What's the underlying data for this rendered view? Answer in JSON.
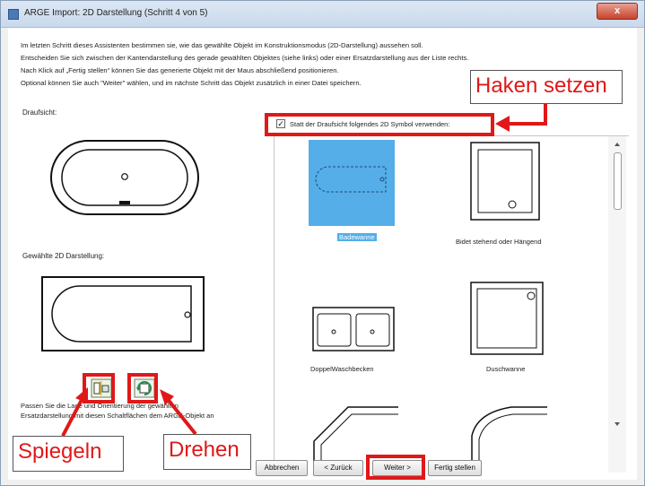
{
  "window": {
    "title": "ARGE Import: 2D Darstellung (Schritt 4 von 5)",
    "close_glyph": "x"
  },
  "intro": {
    "lines": [
      "Im letzten Schritt dieses Assistenten bestimmen sie, wie das gewählte Objekt im Konstruktionsmodus (2D-Darstellung) aussehen soll.",
      "Entscheiden Sie sich zwischen der Kantendarstellung des gerade gewählten Objektes (siehe links) oder einer Ersatzdarstellung aus der Liste rechts.",
      "Nach Klick auf „Fertig stellen“ können Sie das generierte Objekt mit der Maus abschließend positionieren.",
      "Optional können Sie auch \"Weiter\" wählen, und im nächste Schritt das Objekt zusätzlich in einer Datei speichern."
    ]
  },
  "left": {
    "draufsicht_label": "Draufsicht:",
    "gewaehlte_label": "Gewählte 2D Darstellung:",
    "hint_line1": "Passen Sie die Lage und Orientierung der gewählten",
    "hint_line2": "Ersatzdarstellung mit diesen Schaltflächen dem ARGE-Objekt an"
  },
  "checkbox": {
    "checked_glyph": "✓",
    "label": "Statt der Draufsicht folgendes 2D Symbol verwenden:"
  },
  "gallery": {
    "items": [
      {
        "label": "Badewanne",
        "selected": true
      },
      {
        "label": "Bidet stehend oder Hängend",
        "selected": false
      },
      {
        "label": "DoppelWaschbecken",
        "selected": false
      },
      {
        "label": "Duschwanne",
        "selected": false
      }
    ]
  },
  "buttons": {
    "abbrechen": "Abbrechen",
    "zurueck": "< Zurück",
    "weiter": "Weiter >",
    "fertig": "Fertig stellen"
  },
  "callouts": {
    "haken": "Haken setzen",
    "spiegeln": "Spiegeln",
    "drehen": "Drehen"
  },
  "colors": {
    "accent_red": "#e01818",
    "selection_blue": "#55aee8"
  },
  "icons": {
    "mirror": "mirror-icon",
    "rotate": "rotate-icon"
  }
}
